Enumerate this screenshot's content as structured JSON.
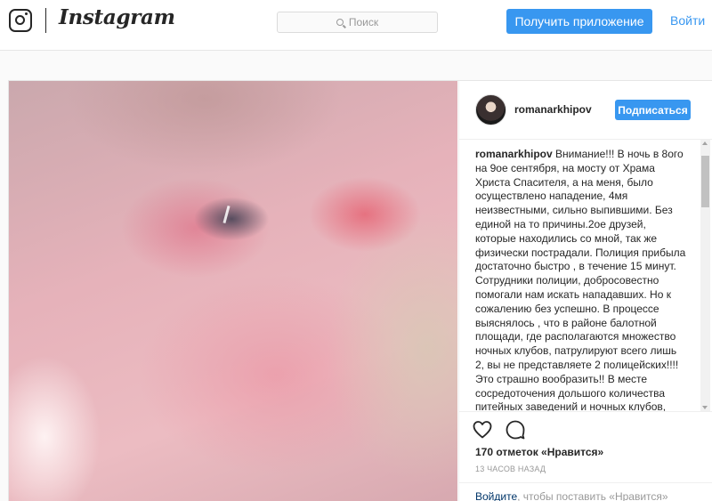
{
  "header": {
    "wordmark": "Instagram",
    "search_placeholder": "Поиск",
    "get_app_label": "Получить приложение",
    "login_label": "Войти"
  },
  "post": {
    "username": "romanarkhipov",
    "follow_label": "Подписаться",
    "caption_user": "romanarkhipov",
    "caption_text": " Внимание!!! В ночь в 8ого на 9ое сентября, на мосту от Храма Христа Спасителя, а на меня, было осуществлено нападение, 4мя неизвестными, сильно выпившими. Без единой на то причины.2ое друзей, которые находились со мной, так же физически пострадали. Полиция прибыла достаточно быстро , в течение 15 минут. Сотрудники полиции, добросовестно помогали нам искать нападавших. Но к сожалению без успешно. В процессе выяснялось , что в районе балотной площади, где располагаются множество ночных клубов, патрулируют всего лишь 2, вы не представляете 2 полицейских!!!! Это страшно вообразить!! В месте сосредоточения дольшого количества питейных заведений и ночных клубов, всего ДВА , сотрудника полиции! Друзья,",
    "likes": "170 отметок «Нравится»",
    "timestamp": "13 ЧАСОВ НАЗАД",
    "login_link": "Войдите",
    "login_hint_rest": ", чтобы поставить «Нравится»"
  },
  "icons": {
    "logo": "instagram-camera-icon",
    "search": "search-icon",
    "heart": "heart-icon",
    "comment": "comment-icon"
  },
  "colors": {
    "accent": "#3897f0",
    "text": "#262626",
    "muted": "#999999"
  }
}
